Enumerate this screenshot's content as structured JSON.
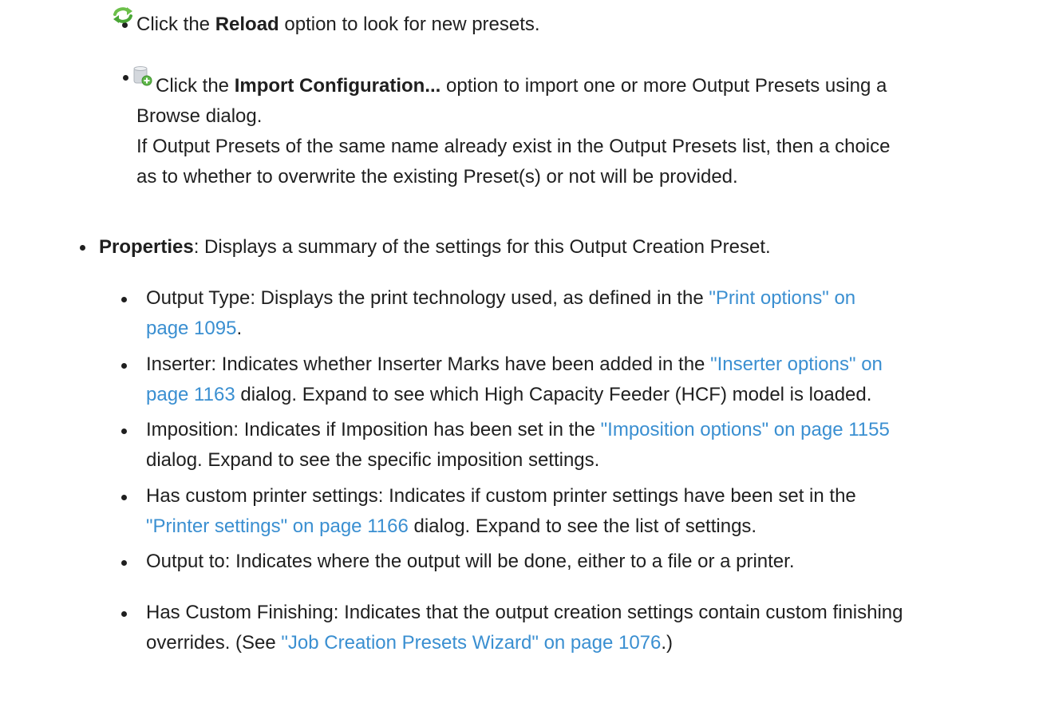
{
  "reload": {
    "pre": "Click the ",
    "bold": "Reload",
    "post": " option to look for new presets.",
    "icon": "reload-icon"
  },
  "import_config": {
    "pre": "Click the ",
    "bold": "Import Configuration...",
    "post_1": " option to import one or more Output Presets using a",
    "line_2": "Browse dialog.",
    "line_3": "If Output Presets of the same name already exist in the Output Presets list, then a choice",
    "line_4": "as to whether to overwrite the existing Preset(s) or not will be provided.",
    "icon": "import-configuration-icon"
  },
  "properties": {
    "bold": "Properties",
    "post": ": Displays a summary of the settings for this Output Creation Preset."
  },
  "output_type": {
    "pre": "Output Type: Displays the print technology used, as defined in the ",
    "link_1": "\"Print options\" on",
    "link_2": "page 1095",
    "post": "."
  },
  "inserter": {
    "pre": "Inserter: Indicates whether Inserter Marks have been added in the ",
    "link_1": "\"Inserter options\" on",
    "link_2": "page 1163",
    "post": " dialog. Expand to see which High Capacity Feeder (HCF) model is loaded."
  },
  "imposition": {
    "pre": "Imposition: Indicates if Imposition has been set in the ",
    "link": "\"Imposition options\" on page 1155",
    "line_2": "dialog. Expand to see the specific imposition settings."
  },
  "custom_printer": {
    "line_1": "Has custom printer settings: Indicates if custom printer settings have been set in the",
    "link": "\"Printer settings\" on page 1166",
    "post": " dialog. Expand to see the list of settings."
  },
  "output_to": {
    "text": "Output to: Indicates where the output will be done, either to a file or a printer."
  },
  "custom_finishing": {
    "line_1": "Has Custom Finishing: Indicates that the output creation settings contain custom finishing",
    "pre_2": "overrides. (See ",
    "link": "\"Job Creation Presets Wizard\" on page 1076",
    "post_2": ".)"
  },
  "colors": {
    "text": "#1f1f1f",
    "link": "#3a8fd1",
    "reload_icon": "#6cc04a",
    "import_icon_body": "#c9ced4",
    "import_icon_badge": "#5fb84a"
  }
}
